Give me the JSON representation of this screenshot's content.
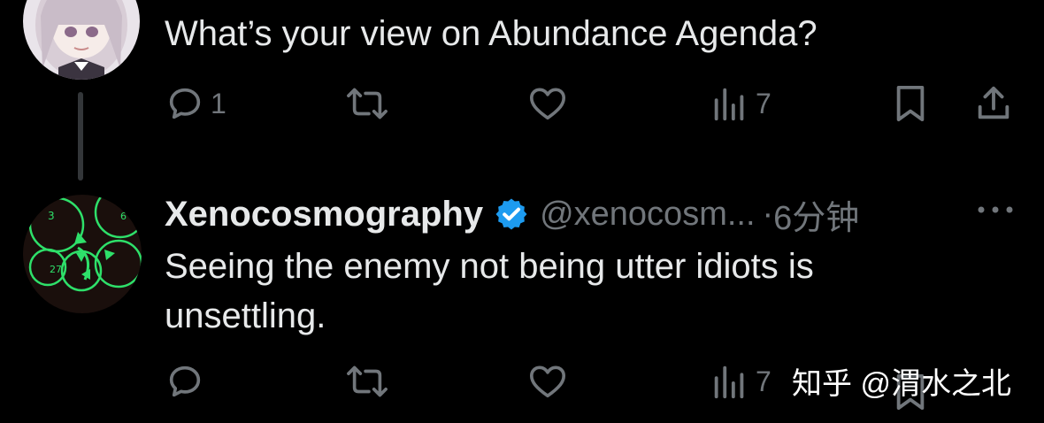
{
  "tweet1": {
    "text": "What’s your view on Abundance Agenda?",
    "actions": {
      "reply_count": "1",
      "views_count": "7"
    }
  },
  "tweet2": {
    "display_name": "Xenocosmography",
    "verified": true,
    "handle": "@xenocosm...",
    "separator": "·",
    "time": "6分钟",
    "text_line1": "Seeing the enemy not being utter idiots is",
    "text_line2": "unsettling.",
    "actions": {
      "views_count": "7"
    }
  },
  "icons": {
    "reply": "reply-icon",
    "retweet": "retweet-icon",
    "like": "heart-icon",
    "views": "views-icon",
    "bookmark": "bookmark-icon",
    "share": "share-icon",
    "more": "more-icon",
    "verified": "verified-badge-icon"
  },
  "colors": {
    "background": "#000000",
    "text_primary": "#e7e9ea",
    "text_secondary": "#71767b",
    "verified_blue": "#1d9bf0",
    "thread_line": "#333639"
  },
  "watermark": "知乎 @渭水之北"
}
